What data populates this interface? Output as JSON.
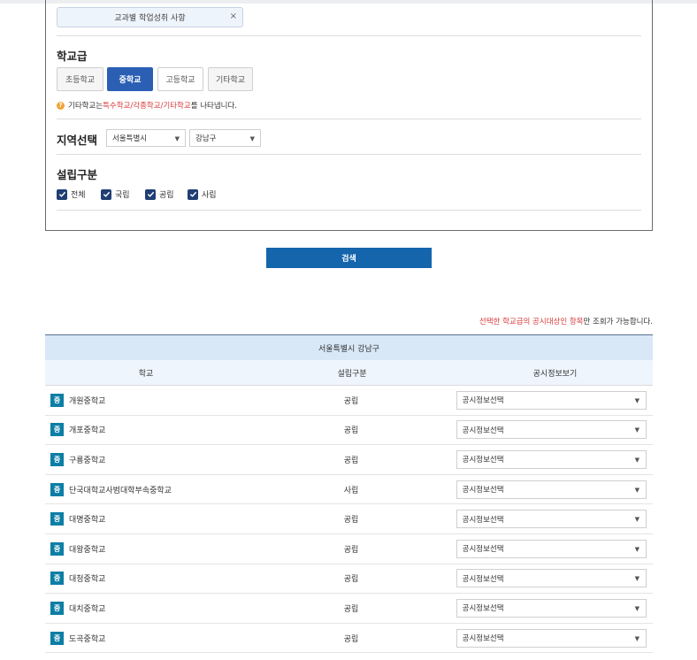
{
  "filter_chip": {
    "label": "교과별 학업성취 사항",
    "remove": "×"
  },
  "school_level": {
    "title": "학교급",
    "tabs": [
      "초등학교",
      "중학교",
      "고등학교",
      "기타학교"
    ],
    "selected": "중학교",
    "note": {
      "prefix": "기타학교는 ",
      "highlight": "특수학교/각종학교/기타학교",
      "suffix": "를 나타냅니다."
    }
  },
  "region": {
    "title": "지역선택",
    "city": "서울특별시",
    "district": "강남구"
  },
  "establishment": {
    "title": "설립구분",
    "options": [
      {
        "label": "전체",
        "checked": true
      },
      {
        "label": "국립",
        "checked": true
      },
      {
        "label": "공립",
        "checked": true
      },
      {
        "label": "사립",
        "checked": true
      }
    ]
  },
  "search_button": "검색",
  "notice": {
    "highlight": "선택한 학교급의 공시대상인 항목",
    "suffix": "만 조회가 가능합니다."
  },
  "results": {
    "region_header": "서울특별시 강남구",
    "columns": [
      "학교",
      "설립구분",
      "공시정보보기"
    ],
    "badge": "중",
    "select_placeholder": "공시정보선택",
    "rows": [
      {
        "name": "개원중학교",
        "type": "공립"
      },
      {
        "name": "개포중학교",
        "type": "공립"
      },
      {
        "name": "구룡중학교",
        "type": "공립"
      },
      {
        "name": "단국대학교사범대학부속중학교",
        "type": "사립"
      },
      {
        "name": "대명중학교",
        "type": "공립"
      },
      {
        "name": "대왕중학교",
        "type": "공립"
      },
      {
        "name": "대청중학교",
        "type": "공립"
      },
      {
        "name": "대치중학교",
        "type": "공립"
      },
      {
        "name": "도곡중학교",
        "type": "공립"
      }
    ]
  }
}
